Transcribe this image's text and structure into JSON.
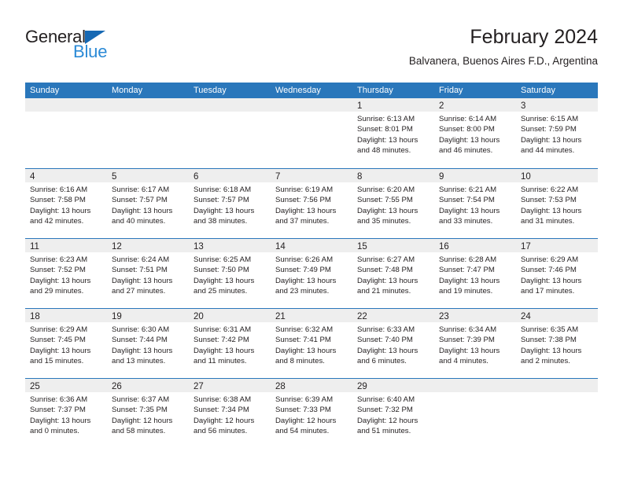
{
  "brand": {
    "name_part1": "General",
    "name_part2": "Blue",
    "triangle_color": "#1668b3",
    "blue_color": "#2b8ad6"
  },
  "header": {
    "title": "February 2024",
    "subtitle": "Balvanera, Buenos Aires F.D., Argentina"
  },
  "colors": {
    "header_blue": "#2a77bb",
    "day_band_gray": "#eeeeee",
    "text": "#231f20"
  },
  "weekdays": [
    "Sunday",
    "Monday",
    "Tuesday",
    "Wednesday",
    "Thursday",
    "Friday",
    "Saturday"
  ],
  "weeks": [
    [
      {
        "day": "",
        "sunrise": "",
        "sunset": "",
        "daylight_line1": "",
        "daylight_line2": ""
      },
      {
        "day": "",
        "sunrise": "",
        "sunset": "",
        "daylight_line1": "",
        "daylight_line2": ""
      },
      {
        "day": "",
        "sunrise": "",
        "sunset": "",
        "daylight_line1": "",
        "daylight_line2": ""
      },
      {
        "day": "",
        "sunrise": "",
        "sunset": "",
        "daylight_line1": "",
        "daylight_line2": ""
      },
      {
        "day": "1",
        "sunrise": "Sunrise: 6:13 AM",
        "sunset": "Sunset: 8:01 PM",
        "daylight_line1": "Daylight: 13 hours",
        "daylight_line2": "and 48 minutes."
      },
      {
        "day": "2",
        "sunrise": "Sunrise: 6:14 AM",
        "sunset": "Sunset: 8:00 PM",
        "daylight_line1": "Daylight: 13 hours",
        "daylight_line2": "and 46 minutes."
      },
      {
        "day": "3",
        "sunrise": "Sunrise: 6:15 AM",
        "sunset": "Sunset: 7:59 PM",
        "daylight_line1": "Daylight: 13 hours",
        "daylight_line2": "and 44 minutes."
      }
    ],
    [
      {
        "day": "4",
        "sunrise": "Sunrise: 6:16 AM",
        "sunset": "Sunset: 7:58 PM",
        "daylight_line1": "Daylight: 13 hours",
        "daylight_line2": "and 42 minutes."
      },
      {
        "day": "5",
        "sunrise": "Sunrise: 6:17 AM",
        "sunset": "Sunset: 7:57 PM",
        "daylight_line1": "Daylight: 13 hours",
        "daylight_line2": "and 40 minutes."
      },
      {
        "day": "6",
        "sunrise": "Sunrise: 6:18 AM",
        "sunset": "Sunset: 7:57 PM",
        "daylight_line1": "Daylight: 13 hours",
        "daylight_line2": "and 38 minutes."
      },
      {
        "day": "7",
        "sunrise": "Sunrise: 6:19 AM",
        "sunset": "Sunset: 7:56 PM",
        "daylight_line1": "Daylight: 13 hours",
        "daylight_line2": "and 37 minutes."
      },
      {
        "day": "8",
        "sunrise": "Sunrise: 6:20 AM",
        "sunset": "Sunset: 7:55 PM",
        "daylight_line1": "Daylight: 13 hours",
        "daylight_line2": "and 35 minutes."
      },
      {
        "day": "9",
        "sunrise": "Sunrise: 6:21 AM",
        "sunset": "Sunset: 7:54 PM",
        "daylight_line1": "Daylight: 13 hours",
        "daylight_line2": "and 33 minutes."
      },
      {
        "day": "10",
        "sunrise": "Sunrise: 6:22 AM",
        "sunset": "Sunset: 7:53 PM",
        "daylight_line1": "Daylight: 13 hours",
        "daylight_line2": "and 31 minutes."
      }
    ],
    [
      {
        "day": "11",
        "sunrise": "Sunrise: 6:23 AM",
        "sunset": "Sunset: 7:52 PM",
        "daylight_line1": "Daylight: 13 hours",
        "daylight_line2": "and 29 minutes."
      },
      {
        "day": "12",
        "sunrise": "Sunrise: 6:24 AM",
        "sunset": "Sunset: 7:51 PM",
        "daylight_line1": "Daylight: 13 hours",
        "daylight_line2": "and 27 minutes."
      },
      {
        "day": "13",
        "sunrise": "Sunrise: 6:25 AM",
        "sunset": "Sunset: 7:50 PM",
        "daylight_line1": "Daylight: 13 hours",
        "daylight_line2": "and 25 minutes."
      },
      {
        "day": "14",
        "sunrise": "Sunrise: 6:26 AM",
        "sunset": "Sunset: 7:49 PM",
        "daylight_line1": "Daylight: 13 hours",
        "daylight_line2": "and 23 minutes."
      },
      {
        "day": "15",
        "sunrise": "Sunrise: 6:27 AM",
        "sunset": "Sunset: 7:48 PM",
        "daylight_line1": "Daylight: 13 hours",
        "daylight_line2": "and 21 minutes."
      },
      {
        "day": "16",
        "sunrise": "Sunrise: 6:28 AM",
        "sunset": "Sunset: 7:47 PM",
        "daylight_line1": "Daylight: 13 hours",
        "daylight_line2": "and 19 minutes."
      },
      {
        "day": "17",
        "sunrise": "Sunrise: 6:29 AM",
        "sunset": "Sunset: 7:46 PM",
        "daylight_line1": "Daylight: 13 hours",
        "daylight_line2": "and 17 minutes."
      }
    ],
    [
      {
        "day": "18",
        "sunrise": "Sunrise: 6:29 AM",
        "sunset": "Sunset: 7:45 PM",
        "daylight_line1": "Daylight: 13 hours",
        "daylight_line2": "and 15 minutes."
      },
      {
        "day": "19",
        "sunrise": "Sunrise: 6:30 AM",
        "sunset": "Sunset: 7:44 PM",
        "daylight_line1": "Daylight: 13 hours",
        "daylight_line2": "and 13 minutes."
      },
      {
        "day": "20",
        "sunrise": "Sunrise: 6:31 AM",
        "sunset": "Sunset: 7:42 PM",
        "daylight_line1": "Daylight: 13 hours",
        "daylight_line2": "and 11 minutes."
      },
      {
        "day": "21",
        "sunrise": "Sunrise: 6:32 AM",
        "sunset": "Sunset: 7:41 PM",
        "daylight_line1": "Daylight: 13 hours",
        "daylight_line2": "and 8 minutes."
      },
      {
        "day": "22",
        "sunrise": "Sunrise: 6:33 AM",
        "sunset": "Sunset: 7:40 PM",
        "daylight_line1": "Daylight: 13 hours",
        "daylight_line2": "and 6 minutes."
      },
      {
        "day": "23",
        "sunrise": "Sunrise: 6:34 AM",
        "sunset": "Sunset: 7:39 PM",
        "daylight_line1": "Daylight: 13 hours",
        "daylight_line2": "and 4 minutes."
      },
      {
        "day": "24",
        "sunrise": "Sunrise: 6:35 AM",
        "sunset": "Sunset: 7:38 PM",
        "daylight_line1": "Daylight: 13 hours",
        "daylight_line2": "and 2 minutes."
      }
    ],
    [
      {
        "day": "25",
        "sunrise": "Sunrise: 6:36 AM",
        "sunset": "Sunset: 7:37 PM",
        "daylight_line1": "Daylight: 13 hours",
        "daylight_line2": "and 0 minutes."
      },
      {
        "day": "26",
        "sunrise": "Sunrise: 6:37 AM",
        "sunset": "Sunset: 7:35 PM",
        "daylight_line1": "Daylight: 12 hours",
        "daylight_line2": "and 58 minutes."
      },
      {
        "day": "27",
        "sunrise": "Sunrise: 6:38 AM",
        "sunset": "Sunset: 7:34 PM",
        "daylight_line1": "Daylight: 12 hours",
        "daylight_line2": "and 56 minutes."
      },
      {
        "day": "28",
        "sunrise": "Sunrise: 6:39 AM",
        "sunset": "Sunset: 7:33 PM",
        "daylight_line1": "Daylight: 12 hours",
        "daylight_line2": "and 54 minutes."
      },
      {
        "day": "29",
        "sunrise": "Sunrise: 6:40 AM",
        "sunset": "Sunset: 7:32 PM",
        "daylight_line1": "Daylight: 12 hours",
        "daylight_line2": "and 51 minutes."
      },
      {
        "day": "",
        "sunrise": "",
        "sunset": "",
        "daylight_line1": "",
        "daylight_line2": ""
      },
      {
        "day": "",
        "sunrise": "",
        "sunset": "",
        "daylight_line1": "",
        "daylight_line2": ""
      }
    ]
  ]
}
